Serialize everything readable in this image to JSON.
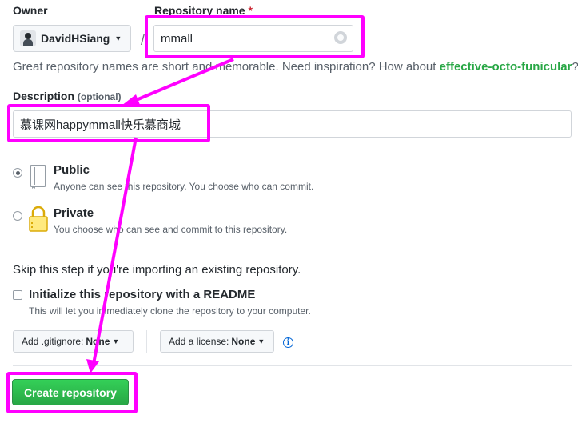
{
  "owner": {
    "heading": "Owner",
    "name": "DavidHSiang"
  },
  "repository": {
    "heading": "Repository name",
    "required_mark": "*",
    "separator": "/",
    "value": "mmall",
    "hint_prefix": "Great repository names are short and memorable. Need inspiration? How about ",
    "hint_suggestion": "effective-octo-funicular",
    "hint_suffix": "?"
  },
  "description": {
    "heading": "Description",
    "optional": "(optional)",
    "value": "慕课网happymmall快乐慕商城"
  },
  "visibility": {
    "public": {
      "title": "Public",
      "desc": "Anyone can see this repository. You choose who can commit."
    },
    "private": {
      "title": "Private",
      "desc": "You choose who can see and commit to this repository."
    }
  },
  "init": {
    "skip_text": "Skip this step if you're importing an existing repository.",
    "readme_title": "Initialize this repository with a README",
    "readme_desc": "This will let you immediately clone the repository to your computer."
  },
  "gitignore": {
    "label": "Add .gitignore:",
    "value": "None"
  },
  "license": {
    "label": "Add a license:",
    "value": "None"
  },
  "create_button": "Create repository",
  "colors": {
    "highlight": "#ff00ff",
    "primary_green": "#28a745",
    "link_blue": "#0366d6"
  }
}
